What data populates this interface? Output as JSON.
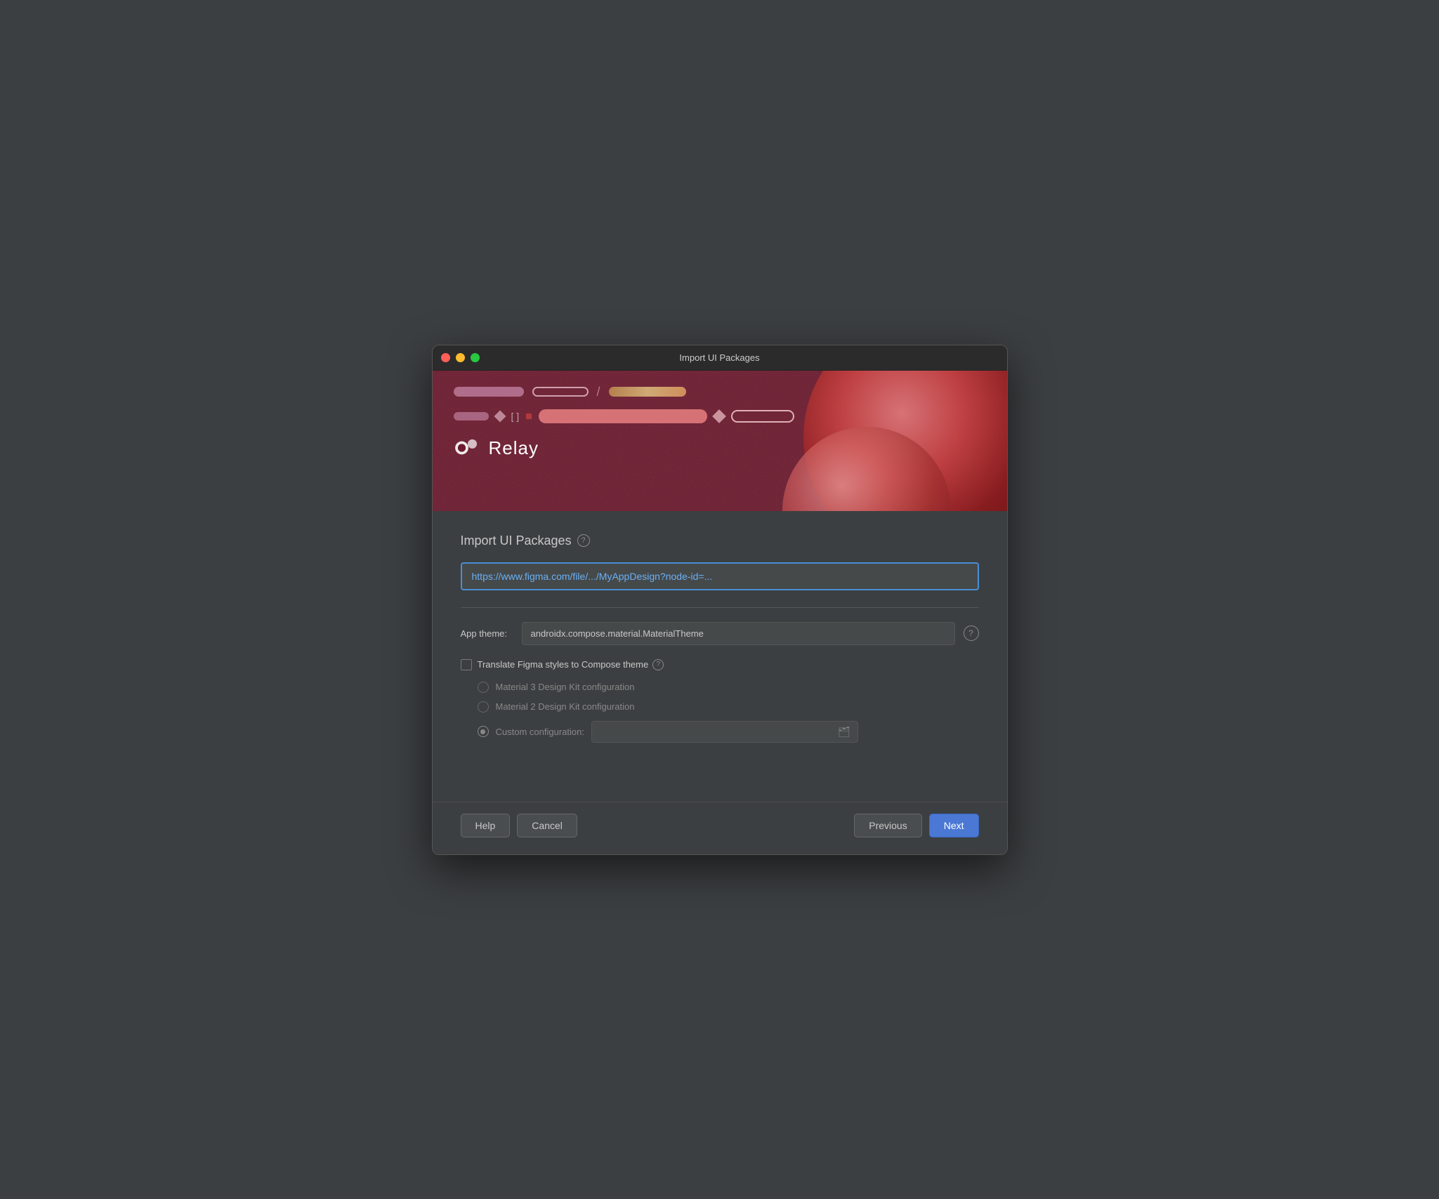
{
  "window": {
    "title": "Import UI Packages"
  },
  "hero": {
    "relay_logo_text": "Relay"
  },
  "main": {
    "section_title": "Import UI Packages",
    "url_input_value": "https://www.figma.com/file/.../MyAppDesign?node-id=...",
    "url_input_placeholder": "https://www.figma.com/file/.../MyAppDesign?node-id=...",
    "app_theme_label": "App theme:",
    "app_theme_value": "androidx.compose.material.MaterialTheme",
    "translate_label": "Translate Figma styles to Compose theme",
    "radio_options": [
      {
        "label": "Material 3 Design Kit configuration",
        "selected": false
      },
      {
        "label": "Material 2 Design Kit configuration",
        "selected": false
      },
      {
        "label": "Custom configuration:",
        "selected": true
      }
    ]
  },
  "footer": {
    "help_label": "Help",
    "cancel_label": "Cancel",
    "previous_label": "Previous",
    "next_label": "Next"
  },
  "icons": {
    "help_circle": "?",
    "folder": "🗂"
  }
}
